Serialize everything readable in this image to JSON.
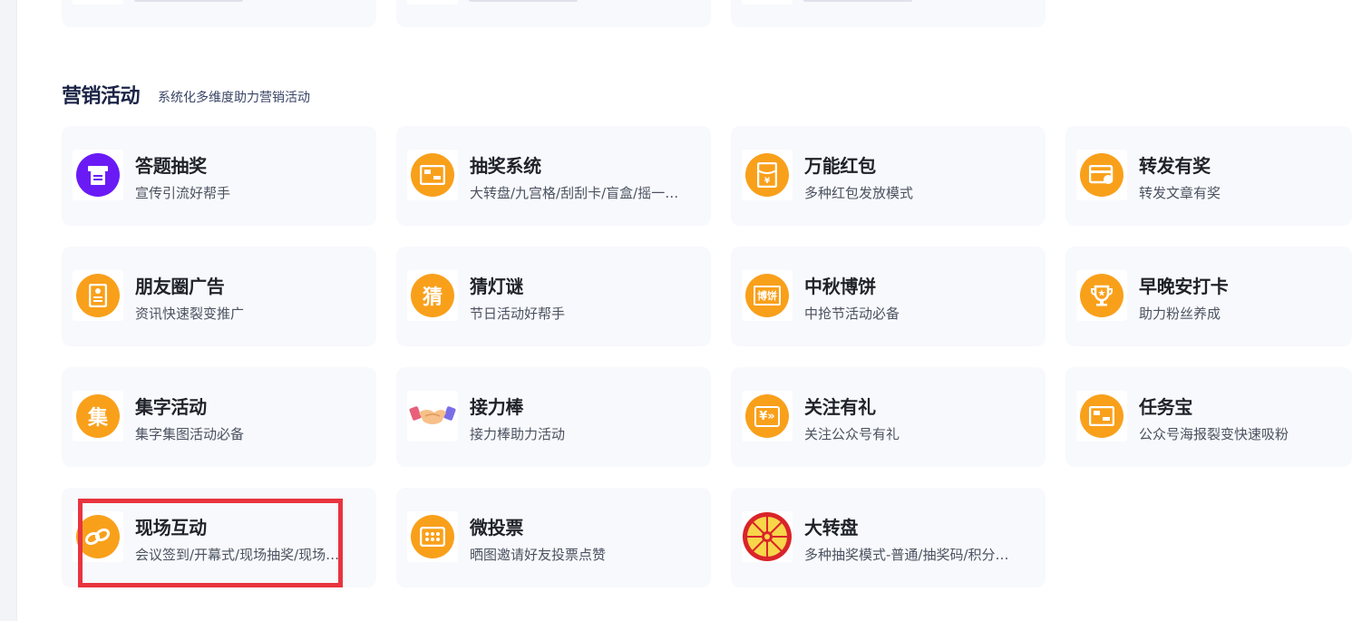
{
  "section": {
    "title": "营销活动",
    "subtitle": "系统化多维度助力营销活动"
  },
  "cards": [
    {
      "title": "答题抽奖",
      "desc": "宣传引流好帮手",
      "icon": "quiz-lottery-icon",
      "color": "#6a1bf5"
    },
    {
      "title": "抽奖系统",
      "desc": "大转盘/九宫格/刮刮卡/盲盒/摇一…",
      "icon": "lottery-system-icon",
      "color": "#f9a01b"
    },
    {
      "title": "万能红包",
      "desc": "多种红包发放模式",
      "icon": "red-packet-icon",
      "color": "#f9a01b"
    },
    {
      "title": "转发有奖",
      "desc": "转发文章有奖",
      "icon": "share-reward-icon",
      "color": "#f9a01b"
    },
    {
      "title": "朋友圈广告",
      "desc": "资讯快速裂变推广",
      "icon": "moments-ad-icon",
      "color": "#f9a01b"
    },
    {
      "title": "猜灯谜",
      "desc": "节日活动好帮手",
      "icon": "lantern-riddle-icon",
      "glyph": "猜",
      "color": "#f9a01b"
    },
    {
      "title": "中秋博饼",
      "desc": "中抢节活动必备",
      "icon": "mooncake-dice-icon",
      "glyph": "博饼",
      "color": "#f9a01b"
    },
    {
      "title": "早晚安打卡",
      "desc": "助力粉丝养成",
      "icon": "trophy-checkin-icon",
      "color": "#f9a01b"
    },
    {
      "title": "集字活动",
      "desc": "集字集图活动必备",
      "icon": "collect-words-icon",
      "glyph": "集",
      "color": "#f9a01b"
    },
    {
      "title": "接力棒",
      "desc": "接力棒助力活动",
      "icon": "handshake-icon",
      "color": "#f9a01b"
    },
    {
      "title": "关注有礼",
      "desc": "关注公众号有礼",
      "icon": "follow-gift-icon",
      "glyph": "¥»",
      "color": "#f9a01b"
    },
    {
      "title": "任务宝",
      "desc": "公众号海报裂变快速吸粉",
      "icon": "task-treasure-icon",
      "color": "#f9a01b"
    },
    {
      "title": "现场互动",
      "desc": "会议签到/开幕式/现场抽奖/现场…",
      "icon": "live-interaction-icon",
      "color": "#f9a01b"
    },
    {
      "title": "微投票",
      "desc": "晒图邀请好友投票点赞",
      "icon": "vote-icon",
      "color": "#f9a01b"
    },
    {
      "title": "大转盘",
      "desc": "多种抽奖模式-普通/抽奖码/积分…",
      "icon": "prize-wheel-icon",
      "color": "#d9242a"
    }
  ],
  "colors": {
    "accent": "#f9a01b",
    "purple": "#6a1bf5",
    "highlight": "#e8343f",
    "card_bg": "#f8f9fc"
  }
}
